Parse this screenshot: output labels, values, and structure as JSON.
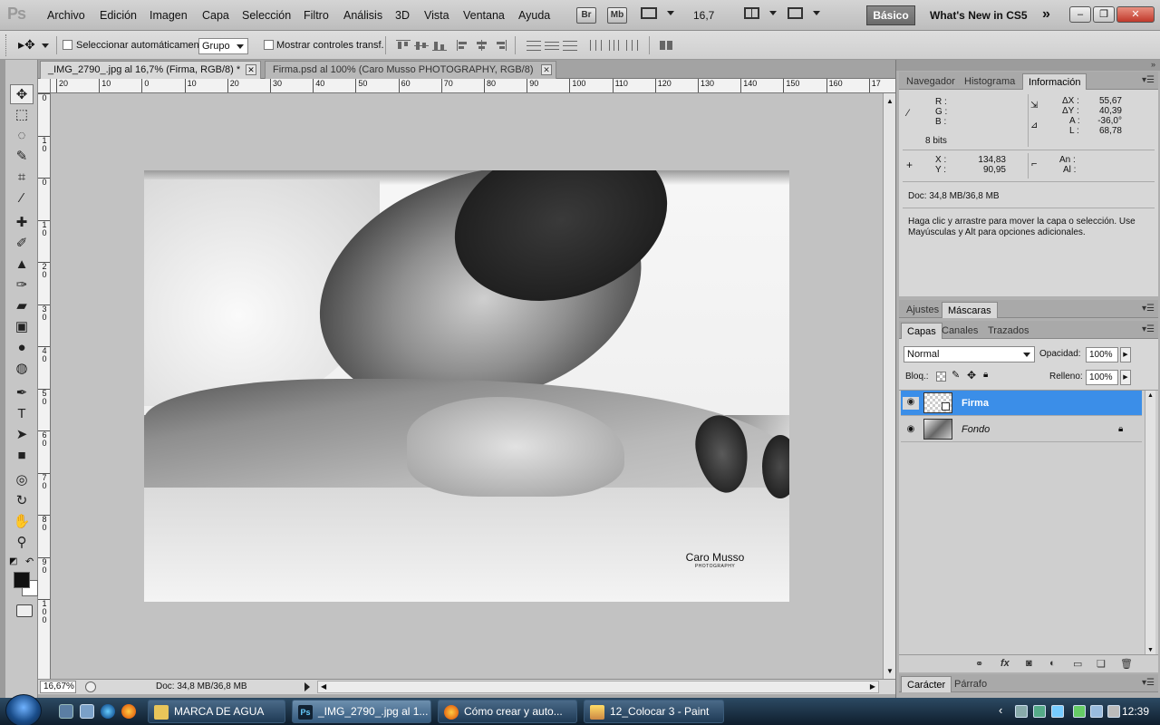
{
  "app": {
    "logo": "Ps",
    "menu": [
      "Archivo",
      "Edición",
      "Imagen",
      "Capa",
      "Selección",
      "Filtro",
      "Análisis",
      "3D",
      "Vista",
      "Ventana",
      "Ayuda"
    ],
    "bridge_label": "Br",
    "minibridge_label": "Mb",
    "zoom_value": "16,7",
    "workspace": "Básico",
    "whats_new": "What's New in CS5"
  },
  "options_bar": {
    "auto_select_label": "Seleccionar automáticamente:",
    "auto_select_value": "Grupo",
    "show_transform_label": "Mostrar controles transf."
  },
  "documents": [
    {
      "title": "_IMG_2790_.jpg al 16,7% (Firma, RGB/8) *",
      "active": true
    },
    {
      "title": "Firma.psd al 100% (Caro Musso  PHOTOGRAPHY, RGB/8)",
      "active": false
    }
  ],
  "ruler": {
    "h_labels": [
      "20",
      "10",
      "0",
      "10",
      "20",
      "30",
      "40",
      "50",
      "60",
      "70",
      "80",
      "90",
      "100",
      "110",
      "120",
      "130",
      "140",
      "150",
      "160",
      "17"
    ],
    "v_labels": [
      "0",
      "1 0",
      "0",
      "1 0",
      "2 0",
      "3 0",
      "4 0",
      "5 0",
      "6 0",
      "7 0",
      "8 0",
      "9 0",
      "1 0 0"
    ]
  },
  "canvas": {
    "watermark_name": "Caro Musso",
    "watermark_sub": "PHOTOGRAPHY"
  },
  "status": {
    "zoom": "16,67%",
    "doc": "Doc: 34,8 MB/36,8 MB"
  },
  "info_panel": {
    "tabs": [
      "Navegador",
      "Histograma",
      "Información"
    ],
    "active_tab": "Información",
    "r_label": "R :",
    "g_label": "G :",
    "b_label": "B :",
    "bits": "8 bits",
    "dx_label": "ΔX :",
    "dy_label": "ΔY :",
    "a_label": "A :",
    "l_label": "L :",
    "dx": "55,67",
    "dy": "40,39",
    "a": "-36,0°",
    "l": "68,78",
    "x_label": "X :",
    "y_label": "Y :",
    "x": "134,83",
    "y": "90,95",
    "w_label": "An :",
    "h_label": "Al :",
    "doc": "Doc: 34,8 MB/36,8 MB",
    "hint": "Haga clic y arrastre para mover la capa o selección. Use Mayúsculas y Alt para opciones adicionales."
  },
  "adjust_panel": {
    "tabs": [
      "Ajustes",
      "Máscaras"
    ],
    "active_tab": "Máscaras"
  },
  "layers_panel": {
    "tabs": [
      "Capas",
      "Canales",
      "Trazados"
    ],
    "active_tab": "Capas",
    "blend_mode": "Normal",
    "opacity_label": "Opacidad:",
    "opacity": "100%",
    "lock_label": "Bloq.:",
    "fill_label": "Relleno:",
    "fill": "100%",
    "layers": [
      {
        "name": "Firma",
        "selected": true,
        "locked": false
      },
      {
        "name": "Fondo",
        "selected": false,
        "locked": true
      }
    ]
  },
  "char_panel": {
    "tabs": [
      "Carácter",
      "Párrafo"
    ],
    "active_tab": "Carácter"
  },
  "taskbar": {
    "tasks": [
      {
        "label": "MARCA DE AGUA",
        "icon": "folder-icon"
      },
      {
        "label": "_IMG_2790_.jpg al 1...",
        "icon": "photoshop-icon"
      },
      {
        "label": "Cómo crear y auto...",
        "icon": "firefox-icon"
      },
      {
        "label": "12_Colocar 3 - Paint",
        "icon": "paint-icon"
      }
    ],
    "clock": "12:39"
  },
  "colors": {
    "selection": "#3b8ee8",
    "close_button": "#c0392b"
  }
}
